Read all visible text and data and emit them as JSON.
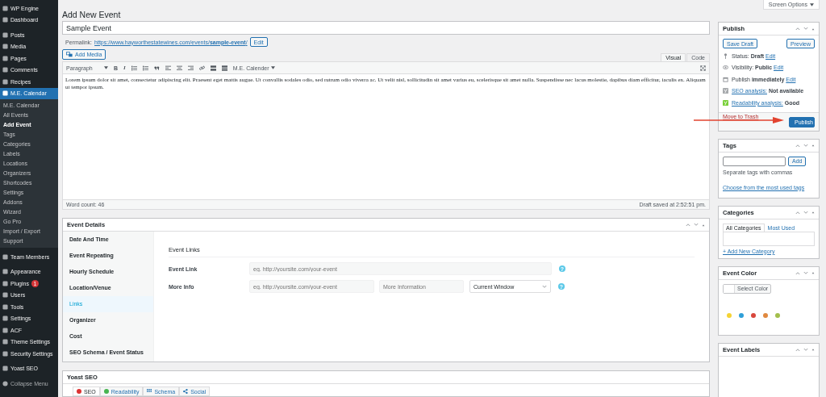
{
  "sidebar": {
    "groups": [
      [
        {
          "label": "WP Engine",
          "selected": false
        },
        {
          "label": "Dashboard",
          "selected": false
        }
      ],
      [
        {
          "label": "Posts",
          "selected": false
        },
        {
          "label": "Media",
          "selected": false
        },
        {
          "label": "Pages",
          "selected": false
        },
        {
          "label": "Comments",
          "selected": false
        },
        {
          "label": "Recipes",
          "selected": false
        },
        {
          "label": "M.E. Calendar",
          "selected": true,
          "children": [
            {
              "label": "M.E. Calendar",
              "selected": false
            },
            {
              "label": "All Events",
              "selected": false
            },
            {
              "label": "Add Event",
              "selected": true
            },
            {
              "label": "Tags",
              "selected": false
            },
            {
              "label": "Categories",
              "selected": false
            },
            {
              "label": "Labels",
              "selected": false
            },
            {
              "label": "Locations",
              "selected": false
            },
            {
              "label": "Organizers",
              "selected": false
            },
            {
              "label": "Shortcodes",
              "selected": false
            },
            {
              "label": "Settings",
              "selected": false
            },
            {
              "label": "Addons",
              "selected": false
            },
            {
              "label": "Wizard",
              "selected": false
            },
            {
              "label": "Go Pro",
              "selected": false
            },
            {
              "label": "Import / Export",
              "selected": false
            },
            {
              "label": "Support",
              "selected": false
            }
          ]
        }
      ],
      [
        {
          "label": "Team Members",
          "selected": false
        }
      ],
      [
        {
          "label": "Appearance",
          "selected": false
        },
        {
          "label": "Plugins",
          "selected": false,
          "badge": "1"
        },
        {
          "label": "Users",
          "selected": false
        },
        {
          "label": "Tools",
          "selected": false
        },
        {
          "label": "Settings",
          "selected": false
        },
        {
          "label": "ACF",
          "selected": false
        },
        {
          "label": "Theme Settings",
          "selected": false
        },
        {
          "label": "Security Settings",
          "selected": false
        }
      ],
      [
        {
          "label": "Yoast SEO",
          "selected": false
        }
      ]
    ],
    "collapse": "Collapse Menu"
  },
  "screen_options": "Screen Options",
  "page_title": "Add New Event",
  "title_value": "Sample Event",
  "permalink": {
    "label": "Permalink:",
    "url": "https://www.hayworthestatewines.com/events/",
    "slug": "sample-event",
    "trail": "/",
    "edit": "Edit"
  },
  "add_media": "Add Media",
  "editor_tabs": [
    {
      "label": "Visual",
      "selected": true
    },
    {
      "label": "Code",
      "selected": false
    }
  ],
  "toolbar": {
    "format": "Paragraph",
    "buttons": [
      {
        "kind": "text",
        "label": "B"
      },
      {
        "kind": "text",
        "label": "I"
      },
      {
        "kind": "bullet-list"
      },
      {
        "kind": "numbered-list"
      },
      {
        "kind": "quote"
      },
      {
        "kind": "align-left"
      },
      {
        "kind": "align-center"
      },
      {
        "kind": "align-right"
      },
      {
        "kind": "link"
      },
      {
        "kind": "read-more"
      },
      {
        "kind": "toolbar-toggle"
      }
    ],
    "plugin_menu": "M.E. Calender"
  },
  "content": "Lorem ipsum dolor sit amet, consectetur adipiscing elit. Praesent eget mattis augue. Ut convallis sodales odio, sed rutrum odio viverra ac. Ut velit nisl, sollicitudin sit amet varius eu, scelerisque sit amet nulla. Suspendisse nec lacus molestie, dapibus diam efficitur, iaculis ex. Aliquam ut tempor ipsum.",
  "word_count": "Word count: 46",
  "draft_saved": "Draft saved at 2:52:51 pm.",
  "event_details": {
    "title": "Event Details",
    "tabs": [
      {
        "label": "Date And Time",
        "selected": false
      },
      {
        "label": "Event Repeating",
        "selected": false
      },
      {
        "label": "Hourly Schedule",
        "selected": false
      },
      {
        "label": "Location/Venue",
        "selected": false
      },
      {
        "label": "Links",
        "selected": true
      },
      {
        "label": "Organizer",
        "selected": false
      },
      {
        "label": "Cost",
        "selected": false
      },
      {
        "label": "SEO Schema / Event Status",
        "selected": false
      }
    ],
    "section_title": "Event Links",
    "rows": [
      {
        "label": "Event Link",
        "inputs": [
          {
            "kind": "text",
            "placeholder": "eg. http://yoursite.com/your-event"
          }
        ],
        "help": "?"
      },
      {
        "label": "More Info",
        "inputs": [
          {
            "kind": "text",
            "placeholder": "eg. http://yoursite.com/your-event"
          },
          {
            "kind": "text",
            "placeholder": "More Information"
          },
          {
            "kind": "select",
            "value": "Current Window"
          }
        ],
        "help": "?"
      }
    ]
  },
  "yoast": {
    "title": "Yoast SEO",
    "tabs": [
      {
        "label": "SEO",
        "kind": "dot",
        "color": "#dc3232",
        "selected": true
      },
      {
        "label": "Readability",
        "kind": "dot",
        "color": "#46b450",
        "selected": false
      },
      {
        "label": "Schema",
        "kind": "grid",
        "selected": false
      },
      {
        "label": "Social",
        "kind": "share",
        "selected": false
      }
    ]
  },
  "publish": {
    "title": "Publish",
    "save_draft": "Save Draft",
    "preview": "Preview",
    "rows": [
      {
        "kind": "status",
        "label": "Status:",
        "value": "Draft",
        "link": "Edit"
      },
      {
        "kind": "visibility",
        "label": "Visibility:",
        "value": "Public",
        "link": "Edit"
      },
      {
        "kind": "schedule",
        "label": "Publish",
        "value": "immediately",
        "link": "Edit"
      },
      {
        "kind": "analysis",
        "color": "#a7aaad",
        "link_label": "SEO analysis:",
        "value": "Not available"
      },
      {
        "kind": "analysis",
        "color": "#7ad03a",
        "link_label": "Readability analysis:",
        "value": "Good"
      }
    ],
    "trash": "Move to Trash",
    "publish": "Publish"
  },
  "tags": {
    "title": "Tags",
    "add": "Add",
    "hint": "Separate tags with commas",
    "choose": "Choose from the most used tags"
  },
  "categories": {
    "title": "Categories",
    "tabs": [
      {
        "label": "All Categories",
        "selected": true
      },
      {
        "label": "Most Used",
        "selected": false
      }
    ],
    "add_new": "+ Add New Category"
  },
  "event_color": {
    "title": "Event Color",
    "select": "Select Color",
    "swatches": [
      {
        "color": "#f5d334"
      },
      {
        "color": "#2f9fd8"
      },
      {
        "color": "#d8473c"
      },
      {
        "color": "#e0893f"
      },
      {
        "color": "#a3bf4c"
      }
    ]
  },
  "event_labels": {
    "title": "Event Labels"
  }
}
